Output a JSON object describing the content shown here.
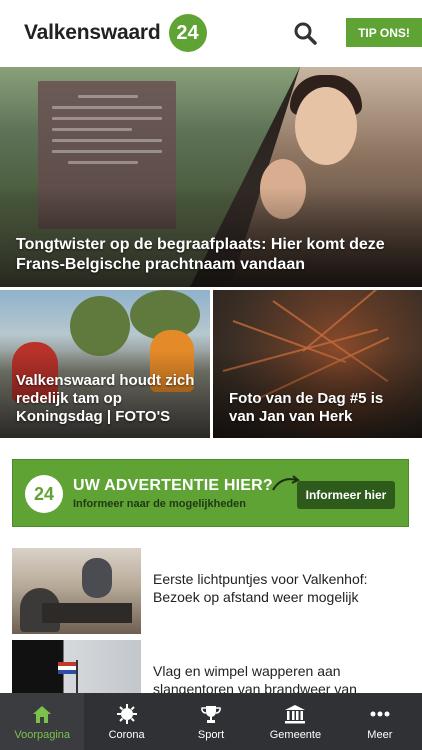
{
  "header": {
    "brand_name": "Valkenswaard",
    "brand_badge": "24",
    "tip_button": "TIP ONS!",
    "accent_color": "#5fa335"
  },
  "hero": {
    "title": "Tongtwister op de begraafplaats: Hier komt deze Frans-Belgische prachtnaam vandaan"
  },
  "tiles": [
    {
      "title": "Valkenswaard houdt zich redelijk tam op Koningsdag | FOTO'S"
    },
    {
      "title": "Foto van de Dag #5 is van Jan van Herk"
    }
  ],
  "ad": {
    "logo": "24",
    "headline": "UW ADVERTENTIE HIER?",
    "subline": "Informeer naar de mogelijkheden",
    "button": "Informeer hier"
  },
  "articles": [
    {
      "title": "Eerste lichtpuntjes voor Valkenhof: Bezoek op afstand weer mogelijk"
    },
    {
      "title": "Vlag en wimpel wapperen aan slangentoren van brandweer van Valkenswaard | VIDEO"
    }
  ],
  "bottom_nav": [
    {
      "label": "Voorpagina",
      "icon": "home-icon",
      "active": true
    },
    {
      "label": "Corona",
      "icon": "virus-icon",
      "active": false
    },
    {
      "label": "Sport",
      "icon": "trophy-icon",
      "active": false
    },
    {
      "label": "Gemeente",
      "icon": "building-icon",
      "active": false
    },
    {
      "label": "Meer",
      "icon": "more-icon",
      "active": false
    }
  ]
}
